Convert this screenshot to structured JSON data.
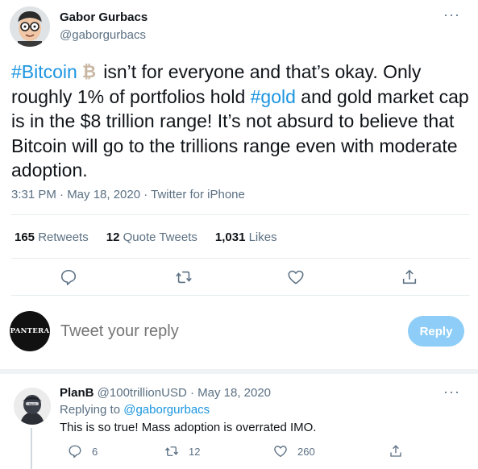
{
  "tweet": {
    "author_name": "Gabor Gurbacs",
    "author_handle": "@gaborgurbacs",
    "hashtag_bitcoin": "#Bitcoin",
    "text_part1": " isn’t for everyone and that’s okay. Only roughly 1% of portfolios hold ",
    "hashtag_gold": "#gold",
    "text_part2": " and gold market cap is in the $8 trillion range! It’s not absurd to believe that Bitcoin will go to the trillions range even with moderate adoption.",
    "meta": "3:31 PM · May 18, 2020 · Twitter for iPhone",
    "more": "···"
  },
  "stats": {
    "retweets_count": "165",
    "retweets_label": " Retweets",
    "quotes_count": "12",
    "quotes_label": " Quote Tweets",
    "likes_count": "1,031",
    "likes_label": " Likes"
  },
  "composer": {
    "avatar_text": "PANTERA",
    "placeholder": "Tweet your reply",
    "reply_label": "Reply"
  },
  "reply": {
    "author_name": "PlanB",
    "author_handle": " @100trillionUSD",
    "date": " · May 18, 2020",
    "replying_prefix": "Replying to ",
    "replying_handle": "@gaborgurbacs",
    "text": "This is so true! Mass adoption is overrated IMO.",
    "reply_count": "6",
    "retweet_count": "12",
    "like_count": "260",
    "more": "···"
  },
  "icons": {
    "reply": "reply-icon",
    "retweet": "retweet-icon",
    "like": "heart-icon",
    "share": "share-icon",
    "bitcoin": "bitcoin-emoji-icon"
  },
  "colors": {
    "link": "#1b95e0",
    "muted": "#5b7083",
    "reply_button": "#8ecdf7",
    "divider": "#e6ecf0"
  }
}
